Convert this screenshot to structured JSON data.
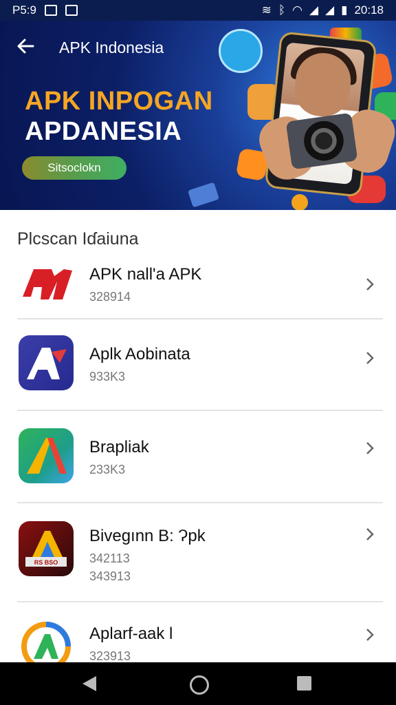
{
  "status_bar": {
    "time_left": "P5:9",
    "time_right": "20:18"
  },
  "header": {
    "title": "APK Indonesia",
    "banner_line1": "APK INPOGAN",
    "banner_line2": "APDANESIA",
    "banner_button": "Sitsoclokn"
  },
  "section": {
    "title": "Plcscan Iɗaiuna"
  },
  "apps": [
    {
      "name": "APK nall'a APK",
      "sub": "328914",
      "sub2": ""
    },
    {
      "name": "Aplk Aobinata",
      "sub": "933K3",
      "sub2": ""
    },
    {
      "name": "Brapliak",
      "sub": "233K3",
      "sub2": ""
    },
    {
      "name": "Bivegınn B: Ɂpk",
      "sub": "342113",
      "sub2": "343913"
    },
    {
      "name": "Aplarf-aak l",
      "sub": "323913",
      "sub2": ""
    }
  ],
  "icon_labels": {
    "app4": "RS BSO"
  },
  "colors": {
    "header_bg": "#0c1f66",
    "banner_yellow": "#f6a623",
    "pill_green": "#3fae63"
  }
}
